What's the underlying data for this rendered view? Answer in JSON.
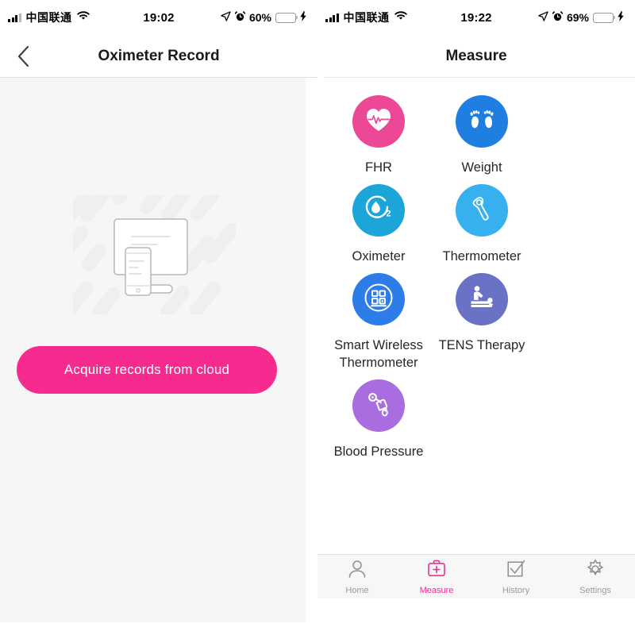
{
  "left": {
    "status": {
      "carrier": "中国联通",
      "time": "19:02",
      "battery_percent": "60%",
      "wifi_icon": "wifi-icon",
      "signal_icon": "cellular-signal-icon",
      "location_icon": "location-arrow-icon",
      "alarm_icon": "alarm-clock-icon",
      "battery_icon": "battery-icon",
      "charging_icon": "charging-bolt-icon"
    },
    "nav": {
      "title": "Oximeter Record",
      "back_icon": "chevron-left-icon"
    },
    "empty_state": {
      "illustration_icon": "monitor-and-phone-illustration",
      "cta_label": "Acquire records from cloud",
      "cta_color": "#f72b8f"
    }
  },
  "right": {
    "status": {
      "carrier": "中国联通",
      "time": "19:22",
      "battery_percent": "69%",
      "wifi_icon": "wifi-icon",
      "signal_icon": "cellular-signal-icon",
      "location_icon": "location-arrow-icon",
      "alarm_icon": "alarm-clock-icon",
      "battery_icon": "battery-icon",
      "charging_icon": "charging-bolt-icon"
    },
    "nav": {
      "title": "Measure"
    },
    "tiles": [
      {
        "label": "FHR",
        "icon": "heart-ecg-icon",
        "color": "#ec4896"
      },
      {
        "label": "Weight",
        "icon": "footprints-icon",
        "color": "#1f7fe0"
      },
      {
        "label": "Oximeter",
        "icon": "oxygen-drop-icon",
        "color": "#1ba5d8"
      },
      {
        "label": "Thermometer",
        "icon": "thermometer-gun-icon",
        "color": "#37b0ef"
      },
      {
        "label": "Smart Wireless Thermometer",
        "icon": "qr-module-icon",
        "color": "#2d7de8"
      },
      {
        "label": "TENS Therapy",
        "icon": "massage-therapy-icon",
        "color": "#6a72c6"
      },
      {
        "label": "Blood Pressure",
        "icon": "blood-pressure-cuff-icon",
        "color": "#a96de0"
      }
    ],
    "tabs": [
      {
        "label": "Home",
        "icon": "person-icon",
        "active": false
      },
      {
        "label": "Measure",
        "icon": "medical-case-icon",
        "active": true
      },
      {
        "label": "History",
        "icon": "checkbox-check-icon",
        "active": false
      },
      {
        "label": "Settings",
        "icon": "gear-icon",
        "active": false
      }
    ],
    "accent_color": "#f72b8f"
  }
}
